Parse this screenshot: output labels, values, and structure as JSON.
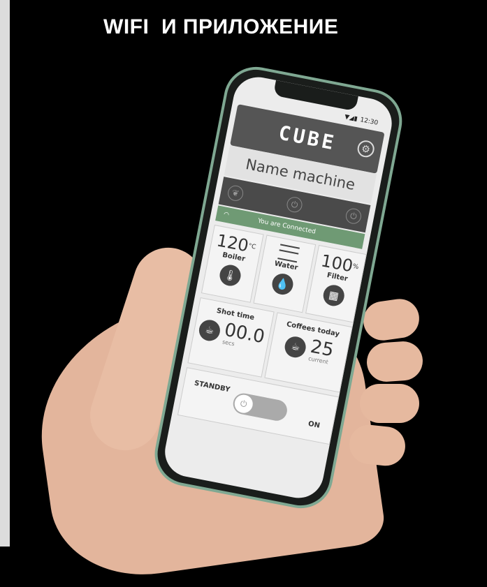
{
  "heading": "WIFI  И ПРИЛОЖЕНИЕ",
  "status_bar": {
    "time": "12:30"
  },
  "app": {
    "logo": "CUBE",
    "machine_name": "Name machine",
    "connection_status": "You are Connected",
    "boiler": {
      "value": "120",
      "unit": "°C",
      "label": "Boiler"
    },
    "water": {
      "label": "Water"
    },
    "filter": {
      "value": "100",
      "unit": "%",
      "label": "Filter"
    },
    "shot_time": {
      "label": "Shot time",
      "value": "00.0",
      "unit": "secs"
    },
    "coffees_today": {
      "label": "Coffees today",
      "value": "25",
      "sub": "current"
    },
    "power": {
      "standby_label": "STANDBY",
      "on_label": "ON"
    }
  },
  "icons": [
    "settings-gear-icon",
    "wifi-icon",
    "leaf-icon",
    "power-icon",
    "thermometer-icon",
    "water-drop-icon",
    "filter-grid-icon",
    "coffee-cup-icon"
  ],
  "colors": {
    "connected_bar": "#6f9a74",
    "header": "#555555",
    "phone_frame": "#7fa892"
  }
}
